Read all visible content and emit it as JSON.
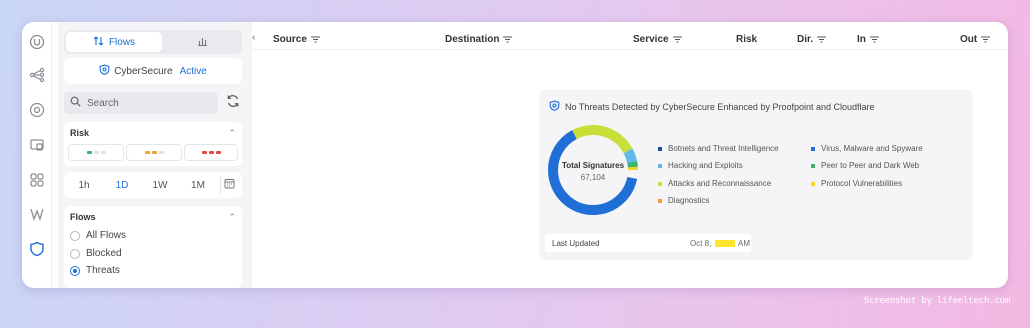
{
  "view_toggle": {
    "flows_label": "Flows"
  },
  "cybersecure": {
    "name": "CyberSecure",
    "status": "Active"
  },
  "search": {
    "placeholder": "Search"
  },
  "risk": {
    "title": "Risk"
  },
  "time_range": {
    "options": [
      "1h",
      "1D",
      "1W",
      "1M"
    ],
    "selected": "1D"
  },
  "flows_filter": {
    "title": "Flows",
    "options": [
      "All Flows",
      "Blocked",
      "Threats"
    ],
    "selected": "Threats"
  },
  "table": {
    "columns": [
      {
        "key": "source",
        "label": "Source"
      },
      {
        "key": "destination",
        "label": "Destination"
      },
      {
        "key": "service",
        "label": "Service"
      },
      {
        "key": "risk",
        "label": "Risk"
      },
      {
        "key": "direction",
        "label": "Dir."
      },
      {
        "key": "in",
        "label": "In"
      },
      {
        "key": "out",
        "label": "Out"
      }
    ]
  },
  "threat_panel": {
    "title": "No Threats Detected by CyberSecure Enhanced by Proofpoint and Cloudflare",
    "donut_label": "Total Signatures",
    "donut_value": "67,104",
    "legend": [
      {
        "label": "Botnets and Threat Intelligence",
        "color": "#1b4f9c"
      },
      {
        "label": "Virus, Malware and Spyware",
        "color": "#1f6fd6"
      },
      {
        "label": "Hacking and Exploits",
        "color": "#5fb8e8"
      },
      {
        "label": "Peer to Peer and Dark Web",
        "color": "#3db36b"
      },
      {
        "label": "Attacks and Reconnaissance",
        "color": "#c8df3a"
      },
      {
        "label": "Protocol Vulnerabilities",
        "color": "#f0d821"
      },
      {
        "label": "Diagnostics",
        "color": "#f0a23a"
      }
    ],
    "last_updated_label": "Last Updated",
    "last_updated_date": "Oct 8,",
    "last_updated_suffix": "AM"
  },
  "colors": {
    "accent": "#1f6fd6"
  },
  "watermark": "Screenshot by lifeeltech.com"
}
